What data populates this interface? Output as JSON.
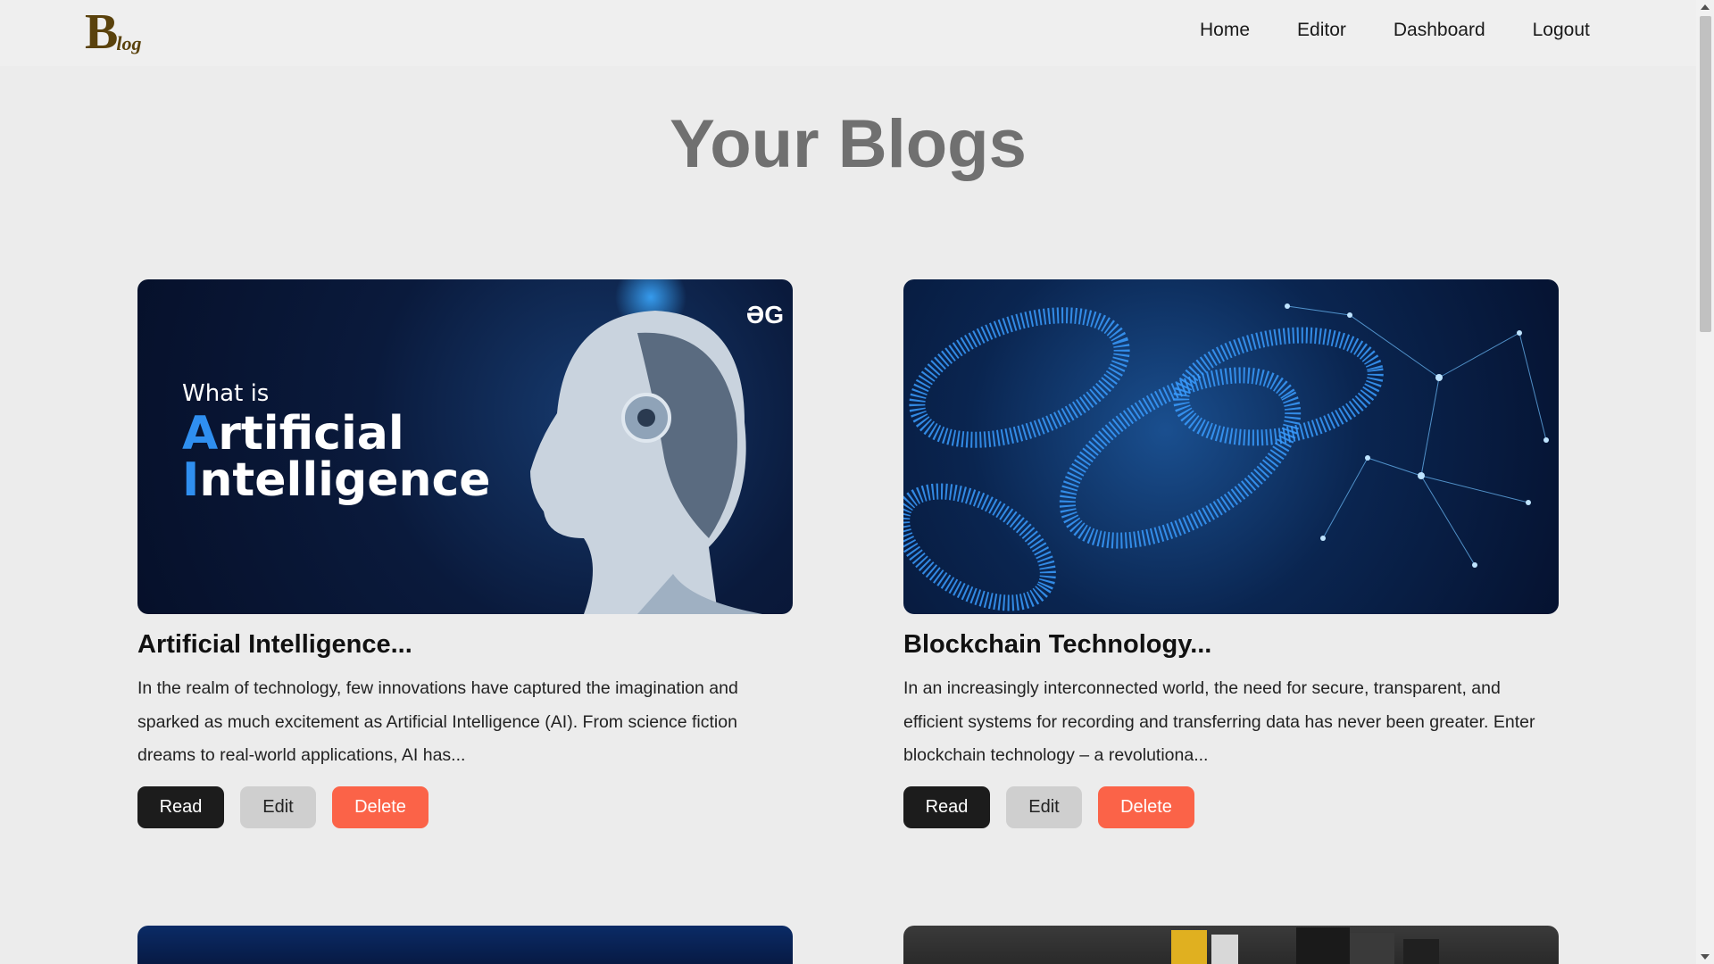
{
  "logo": {
    "big": "B",
    "small": "log"
  },
  "nav": [
    "Home",
    "Editor",
    "Dashboard",
    "Logout"
  ],
  "page_title": "Your Blogs",
  "cards": [
    {
      "title": "Artificial Intelligence...",
      "excerpt": "In the realm of technology, few innovations have captured the imagination and sparked as much excitement as Artificial Intelligence (AI). From science fiction dreams to real-world applications, AI has...",
      "thumb_line1": "What is",
      "thumb_line2a": "A",
      "thumb_line2b": "rtificial",
      "thumb_line3a": "I",
      "thumb_line3b": "ntelligence",
      "thumb_brand": "ƏG",
      "read": "Read",
      "edit": "Edit",
      "delete": "Delete"
    },
    {
      "title": "Blockchain Technology...",
      "excerpt": "In an increasingly interconnected world, the need for secure, transparent, and efficient systems for recording and transferring data has never been greater. Enter blockchain technology – a revolutiona...",
      "read": "Read",
      "edit": "Edit",
      "delete": "Delete"
    }
  ],
  "colors": {
    "read": "#1c1c1c",
    "edit": "#cfcfcf",
    "delete": "#fb6348",
    "logo": "#5a420c"
  }
}
